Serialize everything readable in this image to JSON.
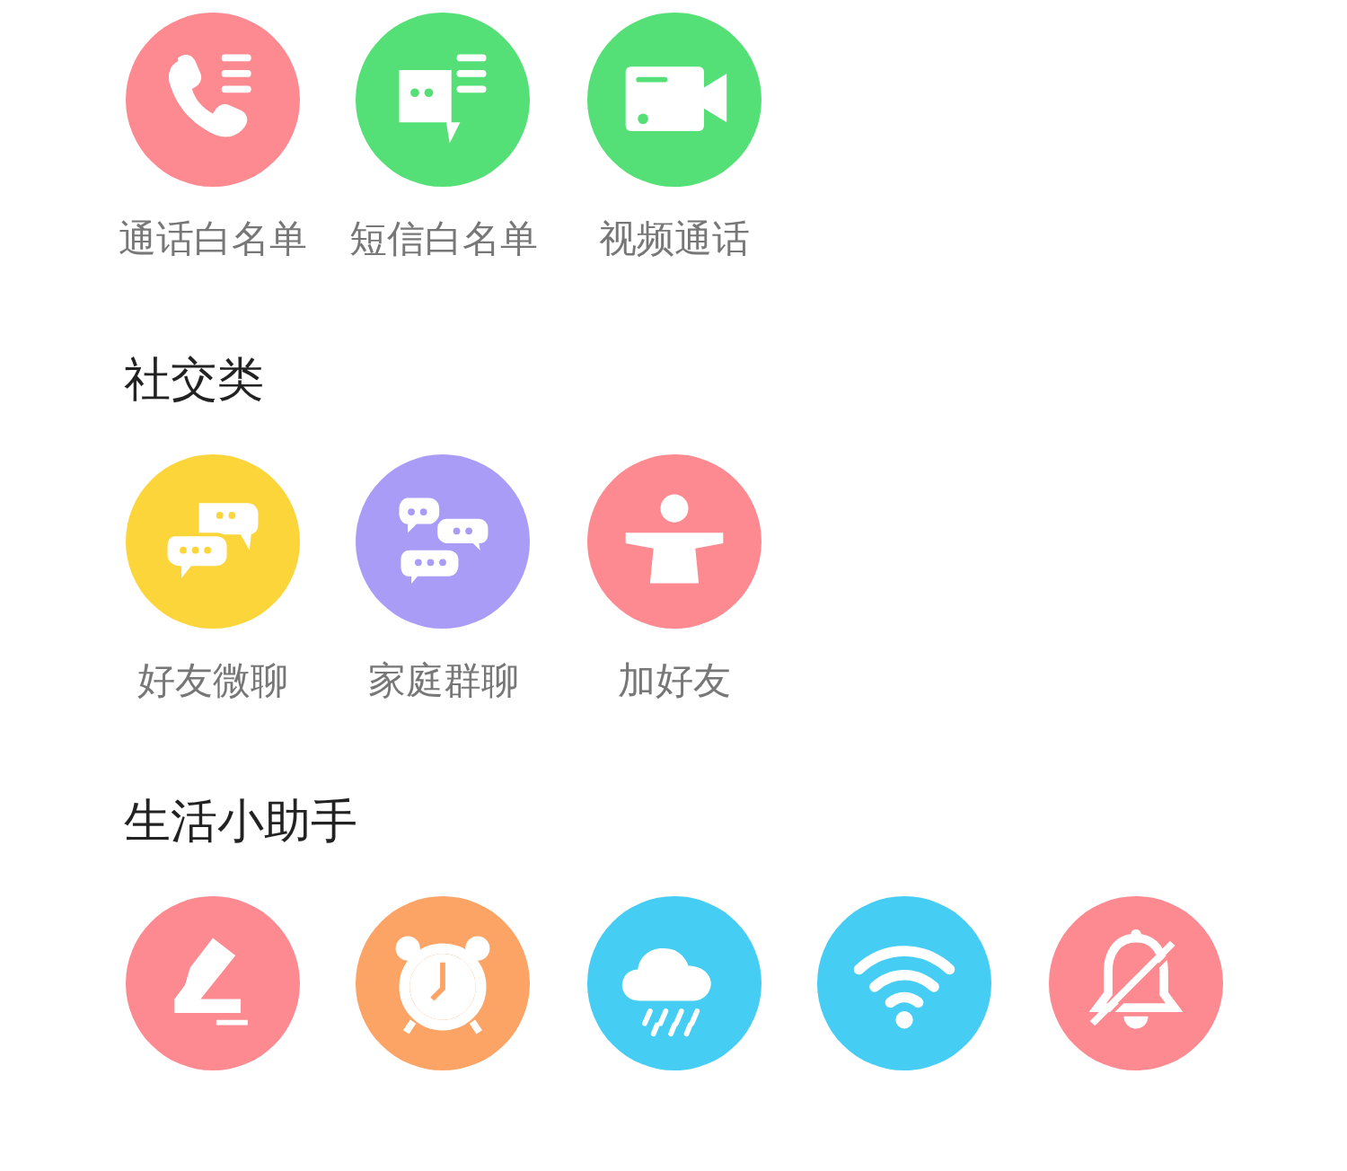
{
  "sections": [
    {
      "items": [
        {
          "label": "通话白名单",
          "color": "#fc8a90"
        },
        {
          "label": "短信白名单",
          "color": "#55e077"
        },
        {
          "label": "视频通话",
          "color": "#55e077"
        }
      ]
    },
    {
      "title": "社交类",
      "items": [
        {
          "label": "好友微聊",
          "color": "#fcd53b"
        },
        {
          "label": "家庭群聊",
          "color": "#a99cf7"
        },
        {
          "label": "加好友",
          "color": "#fc8a90"
        }
      ]
    },
    {
      "title": "生活小助手",
      "items": [
        {
          "color": "#fc8a90"
        },
        {
          "color": "#fca466"
        },
        {
          "color": "#45cdf4"
        },
        {
          "color": "#45cdf4"
        },
        {
          "color": "#fc8a90"
        }
      ]
    }
  ]
}
